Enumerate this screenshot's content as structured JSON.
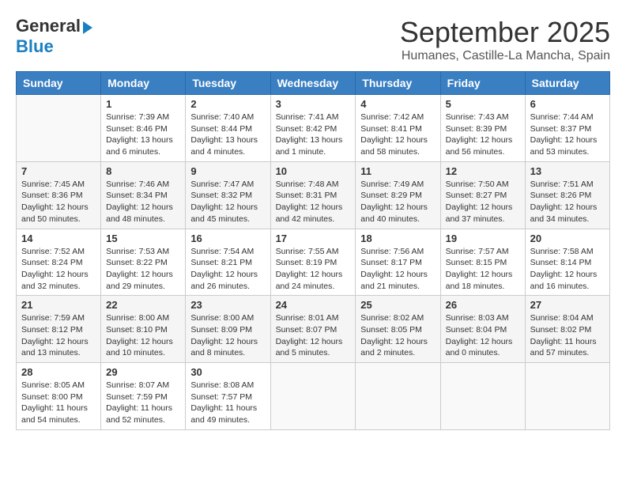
{
  "header": {
    "logo_line1": "General",
    "logo_line2": "Blue",
    "title": "September 2025",
    "subtitle": "Humanes, Castille-La Mancha, Spain"
  },
  "weekdays": [
    "Sunday",
    "Monday",
    "Tuesday",
    "Wednesday",
    "Thursday",
    "Friday",
    "Saturday"
  ],
  "weeks": [
    [
      {
        "day": "",
        "info": ""
      },
      {
        "day": "1",
        "info": "Sunrise: 7:39 AM\nSunset: 8:46 PM\nDaylight: 13 hours\nand 6 minutes."
      },
      {
        "day": "2",
        "info": "Sunrise: 7:40 AM\nSunset: 8:44 PM\nDaylight: 13 hours\nand 4 minutes."
      },
      {
        "day": "3",
        "info": "Sunrise: 7:41 AM\nSunset: 8:42 PM\nDaylight: 13 hours\nand 1 minute."
      },
      {
        "day": "4",
        "info": "Sunrise: 7:42 AM\nSunset: 8:41 PM\nDaylight: 12 hours\nand 58 minutes."
      },
      {
        "day": "5",
        "info": "Sunrise: 7:43 AM\nSunset: 8:39 PM\nDaylight: 12 hours\nand 56 minutes."
      },
      {
        "day": "6",
        "info": "Sunrise: 7:44 AM\nSunset: 8:37 PM\nDaylight: 12 hours\nand 53 minutes."
      }
    ],
    [
      {
        "day": "7",
        "info": "Sunrise: 7:45 AM\nSunset: 8:36 PM\nDaylight: 12 hours\nand 50 minutes."
      },
      {
        "day": "8",
        "info": "Sunrise: 7:46 AM\nSunset: 8:34 PM\nDaylight: 12 hours\nand 48 minutes."
      },
      {
        "day": "9",
        "info": "Sunrise: 7:47 AM\nSunset: 8:32 PM\nDaylight: 12 hours\nand 45 minutes."
      },
      {
        "day": "10",
        "info": "Sunrise: 7:48 AM\nSunset: 8:31 PM\nDaylight: 12 hours\nand 42 minutes."
      },
      {
        "day": "11",
        "info": "Sunrise: 7:49 AM\nSunset: 8:29 PM\nDaylight: 12 hours\nand 40 minutes."
      },
      {
        "day": "12",
        "info": "Sunrise: 7:50 AM\nSunset: 8:27 PM\nDaylight: 12 hours\nand 37 minutes."
      },
      {
        "day": "13",
        "info": "Sunrise: 7:51 AM\nSunset: 8:26 PM\nDaylight: 12 hours\nand 34 minutes."
      }
    ],
    [
      {
        "day": "14",
        "info": "Sunrise: 7:52 AM\nSunset: 8:24 PM\nDaylight: 12 hours\nand 32 minutes."
      },
      {
        "day": "15",
        "info": "Sunrise: 7:53 AM\nSunset: 8:22 PM\nDaylight: 12 hours\nand 29 minutes."
      },
      {
        "day": "16",
        "info": "Sunrise: 7:54 AM\nSunset: 8:21 PM\nDaylight: 12 hours\nand 26 minutes."
      },
      {
        "day": "17",
        "info": "Sunrise: 7:55 AM\nSunset: 8:19 PM\nDaylight: 12 hours\nand 24 minutes."
      },
      {
        "day": "18",
        "info": "Sunrise: 7:56 AM\nSunset: 8:17 PM\nDaylight: 12 hours\nand 21 minutes."
      },
      {
        "day": "19",
        "info": "Sunrise: 7:57 AM\nSunset: 8:15 PM\nDaylight: 12 hours\nand 18 minutes."
      },
      {
        "day": "20",
        "info": "Sunrise: 7:58 AM\nSunset: 8:14 PM\nDaylight: 12 hours\nand 16 minutes."
      }
    ],
    [
      {
        "day": "21",
        "info": "Sunrise: 7:59 AM\nSunset: 8:12 PM\nDaylight: 12 hours\nand 13 minutes."
      },
      {
        "day": "22",
        "info": "Sunrise: 8:00 AM\nSunset: 8:10 PM\nDaylight: 12 hours\nand 10 minutes."
      },
      {
        "day": "23",
        "info": "Sunrise: 8:00 AM\nSunset: 8:09 PM\nDaylight: 12 hours\nand 8 minutes."
      },
      {
        "day": "24",
        "info": "Sunrise: 8:01 AM\nSunset: 8:07 PM\nDaylight: 12 hours\nand 5 minutes."
      },
      {
        "day": "25",
        "info": "Sunrise: 8:02 AM\nSunset: 8:05 PM\nDaylight: 12 hours\nand 2 minutes."
      },
      {
        "day": "26",
        "info": "Sunrise: 8:03 AM\nSunset: 8:04 PM\nDaylight: 12 hours\nand 0 minutes."
      },
      {
        "day": "27",
        "info": "Sunrise: 8:04 AM\nSunset: 8:02 PM\nDaylight: 11 hours\nand 57 minutes."
      }
    ],
    [
      {
        "day": "28",
        "info": "Sunrise: 8:05 AM\nSunset: 8:00 PM\nDaylight: 11 hours\nand 54 minutes."
      },
      {
        "day": "29",
        "info": "Sunrise: 8:07 AM\nSunset: 7:59 PM\nDaylight: 11 hours\nand 52 minutes."
      },
      {
        "day": "30",
        "info": "Sunrise: 8:08 AM\nSunset: 7:57 PM\nDaylight: 11 hours\nand 49 minutes."
      },
      {
        "day": "",
        "info": ""
      },
      {
        "day": "",
        "info": ""
      },
      {
        "day": "",
        "info": ""
      },
      {
        "day": "",
        "info": ""
      }
    ]
  ]
}
